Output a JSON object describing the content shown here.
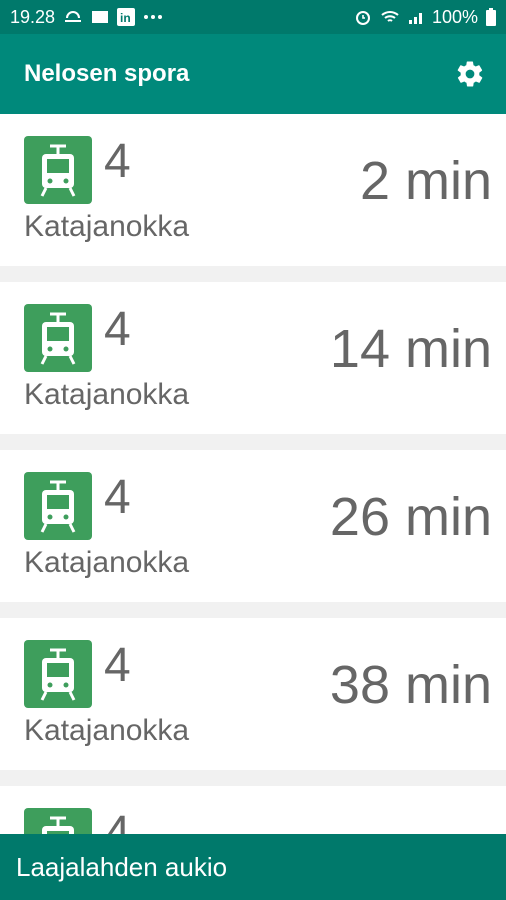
{
  "status_bar": {
    "time": "19.28",
    "battery": "100%",
    "icons": [
      "weather-icon",
      "image-icon",
      "linkedin-icon",
      "more-icon",
      "alarm-icon",
      "wifi-icon",
      "signal-icon",
      "battery-icon"
    ]
  },
  "app_bar": {
    "title": "Nelosen spora",
    "settings_icon": "gear-icon"
  },
  "departures": [
    {
      "line": "4",
      "destination": "Katajanokka",
      "eta": "2 min"
    },
    {
      "line": "4",
      "destination": "Katajanokka",
      "eta": "14 min"
    },
    {
      "line": "4",
      "destination": "Katajanokka",
      "eta": "26 min"
    },
    {
      "line": "4",
      "destination": "Katajanokka",
      "eta": "38 min"
    },
    {
      "line": "4",
      "destination": "",
      "eta": ""
    }
  ],
  "bottom_bar": {
    "stop_name": "Laajalahden aukio"
  },
  "colors": {
    "primary": "#00897b",
    "primary_dark": "#00796b",
    "tram_badge": "#3e9e5c",
    "text": "#666666",
    "background": "#f1f1f1"
  }
}
